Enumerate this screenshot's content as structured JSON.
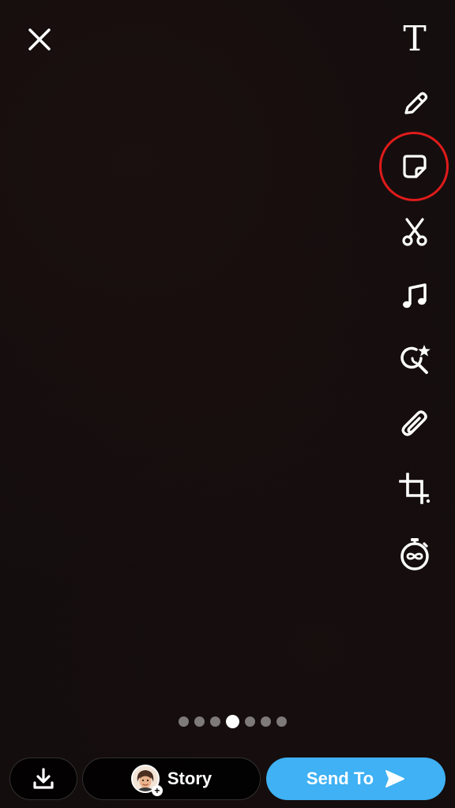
{
  "header": {
    "close_icon": "close-icon"
  },
  "toolbar": {
    "text_tool_glyph": "T",
    "tools": [
      {
        "name": "text-tool",
        "icon": "text-icon"
      },
      {
        "name": "draw-tool",
        "icon": "pencil-icon"
      },
      {
        "name": "sticker-tool",
        "icon": "sticker-icon"
      },
      {
        "name": "scissors-tool",
        "icon": "scissors-icon"
      },
      {
        "name": "music-tool",
        "icon": "music-note-icon"
      },
      {
        "name": "lens-tool",
        "icon": "lens-search-star-icon"
      },
      {
        "name": "attachment-tool",
        "icon": "paperclip-icon"
      },
      {
        "name": "crop-tool",
        "icon": "crop-icon"
      },
      {
        "name": "timer-tool",
        "icon": "timer-infinity-icon"
      }
    ],
    "highlight_color": "#e01b1b"
  },
  "pager": {
    "total": 7,
    "active_index": 3
  },
  "bottom": {
    "save_icon": "download-icon",
    "story_label": "Story",
    "send_label": "Send To",
    "send_color": "#3fb1f4"
  }
}
